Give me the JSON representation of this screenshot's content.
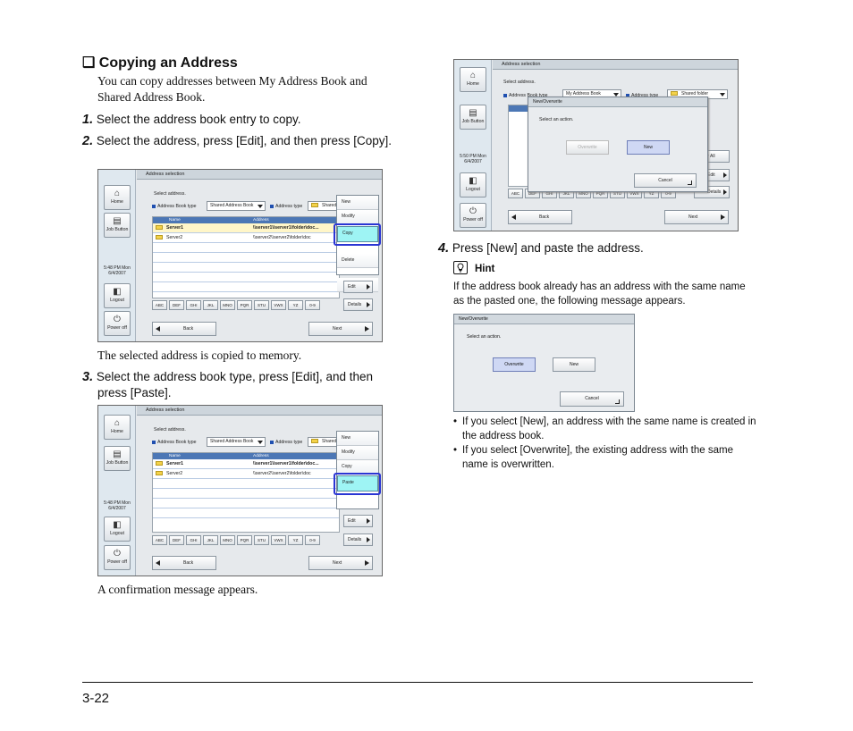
{
  "section": {
    "checkbox": "❑",
    "title": "Copying an Address",
    "intro": "You can copy addresses between My Address Book and Shared Address Book."
  },
  "steps": [
    {
      "num": "1.",
      "text": "Select the address book entry to copy."
    },
    {
      "num": "2.",
      "text": "Select the address, press [Edit], and then press [Copy]."
    },
    {
      "num": "3.",
      "text": "Select the address book type, press [Edit], and then press [Paste]."
    },
    {
      "num": "4.",
      "text": "Press [New] and paste the address."
    }
  ],
  "captions": {
    "after_step2": "The selected address is copied to memory.",
    "after_step3": "A confirmation message appears."
  },
  "hint": {
    "label": "Hint",
    "text": "If the address book already has an address with the same name as the pasted one, the following message appears.",
    "bullets": [
      "If you select [New], an address with the same name is created in the address book.",
      "If you select [Overwrite], the existing address with the same name is overwritten."
    ]
  },
  "footer": {
    "page": "3-22"
  },
  "ui": {
    "window_title": "Address selection",
    "select_address": "Select address.",
    "book_type_label": "Address Book type",
    "book_type_value": "Shared Address Book",
    "book_type_value_my": "My Address Book",
    "address_type_label": "Address type",
    "address_type_value": "Shared",
    "address_type_value_full": "Shared folder",
    "col_name": "Name",
    "col_address": "Address",
    "rows": [
      {
        "name": "Server1",
        "address": "\\\\server1\\\\server1\\folder\\doc..."
      },
      {
        "name": "Server2",
        "address": "\\\\server2\\\\server2\\folder\\doc"
      }
    ],
    "alpha": [
      "ABC",
      "DEF",
      "GHI",
      "JKL",
      "MNO",
      "PQR",
      "STU",
      "VWX",
      "YZ",
      "0-9"
    ],
    "menu": [
      "New",
      "Modify",
      "Copy",
      "Paste",
      "Delete"
    ],
    "edit": "Edit",
    "details": "Details",
    "clear_all": "Clear All",
    "back": "Back",
    "next": "Next",
    "side": {
      "home": "Home",
      "job": "Job Button",
      "time1": "5:48 PM  Mon",
      "time2": "5:50 PM  Mon",
      "date": "6/4/2007",
      "logout": "Logout",
      "power": "Power off"
    },
    "dialog": {
      "title": "New/Overwrite",
      "message": "Select an action.",
      "overwrite": "Overwrite",
      "new": "New",
      "cancel": "Cancel"
    }
  },
  "colors": {
    "highlight_ring": "#2a35d4",
    "table_header": "#4c77b5",
    "menu_highlight": "#9ef4f4"
  }
}
